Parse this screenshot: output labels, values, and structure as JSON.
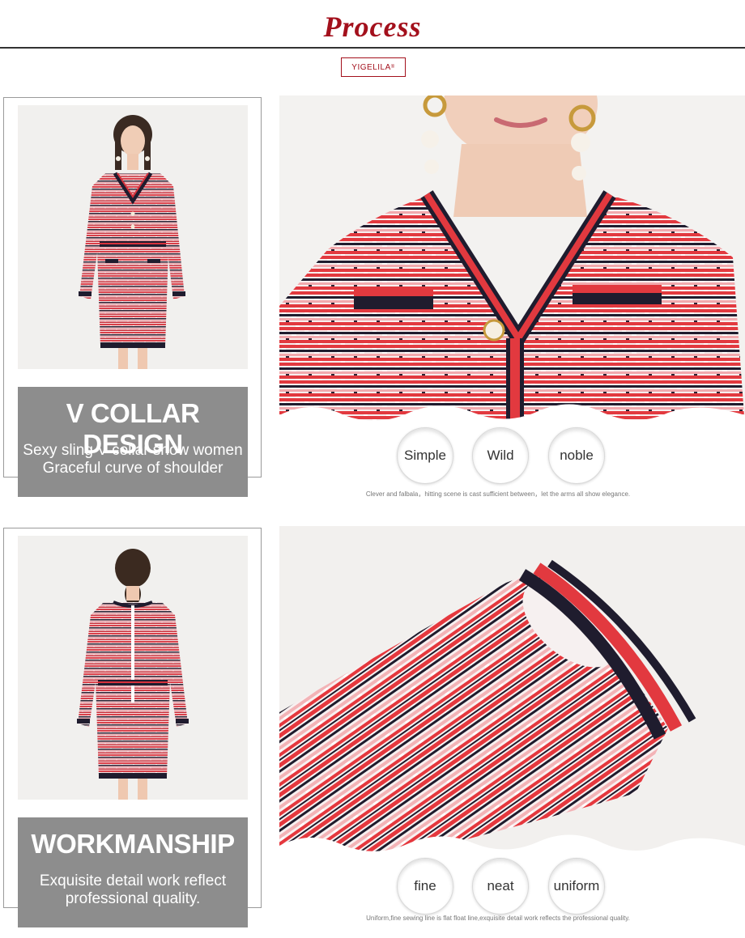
{
  "header": {
    "title": "Process",
    "brand": "YIGELILA",
    "brand_mark": "®"
  },
  "sections": [
    {
      "caption_title": "V COLLAR DESIGN",
      "caption_line1": "Sexy sling V collar show women",
      "caption_line2": "Graceful curve of shoulder",
      "badges": [
        "Simple",
        "Wild",
        "noble"
      ],
      "note": "Clever and falbala，hitting scene is cast sufficient between，let the arms all show elegance."
    },
    {
      "caption_title": "WORKMANSHIP",
      "caption_line1": "Exquisite detail work reflect",
      "caption_line2": "professional quality.",
      "badges": [
        "fine",
        "neat",
        "uniform"
      ],
      "note": "Uniform,fine sewing line is flat float line,exquisite detail work reflects the professional quality."
    }
  ],
  "colors": {
    "accent": "#a3101c",
    "caption_bg": "#8d8d8d",
    "fabric_red": "#e03b3f",
    "fabric_navy": "#1d2040"
  }
}
